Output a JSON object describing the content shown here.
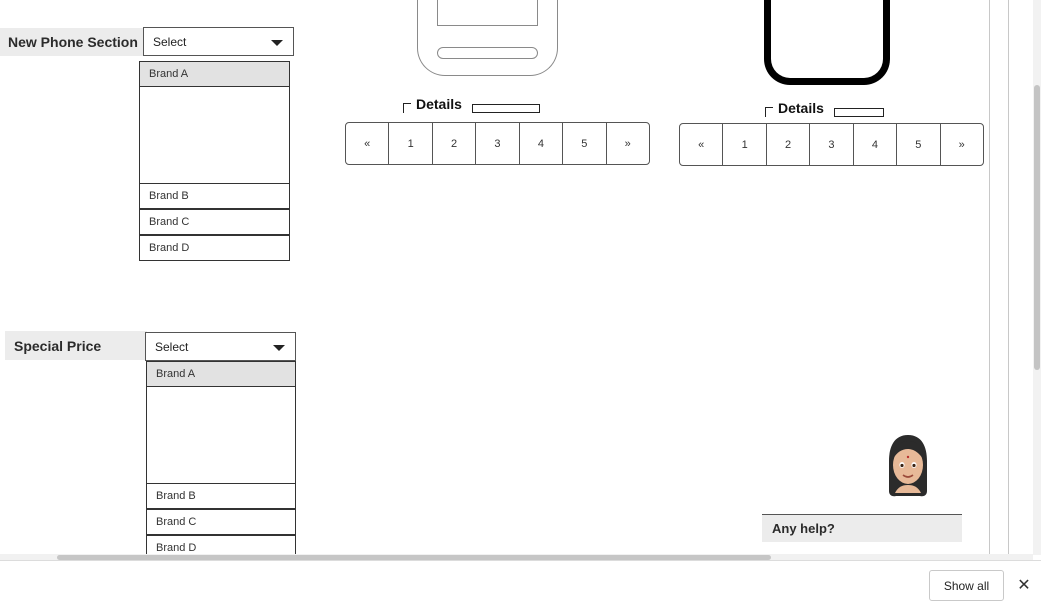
{
  "sections": [
    {
      "label": "New Phone Section",
      "select_value": "Select",
      "options": [
        "Brand A",
        "Brand B",
        "Brand C",
        "Brand D"
      ]
    },
    {
      "label": "Special Price",
      "select_value": "Select",
      "options": [
        "Brand A",
        "Brand B",
        "Brand C",
        "Brand D"
      ]
    }
  ],
  "details_left": {
    "title": "Details",
    "pager": [
      "«",
      "1",
      "2",
      "3",
      "4",
      "5",
      "»"
    ]
  },
  "details_right": {
    "title": "Details",
    "pager": [
      "«",
      "1",
      "2",
      "3",
      "4",
      "5",
      "»"
    ]
  },
  "help": {
    "label": "Any help?"
  },
  "download_bar": {
    "show_all": "Show all",
    "close": "✕"
  },
  "icons": {
    "left_phone": "phone-outline-icon",
    "right_phone": "phone-bold-icon",
    "assistant": "assistant-avatar-icon",
    "caret": "chevron-down-icon"
  }
}
